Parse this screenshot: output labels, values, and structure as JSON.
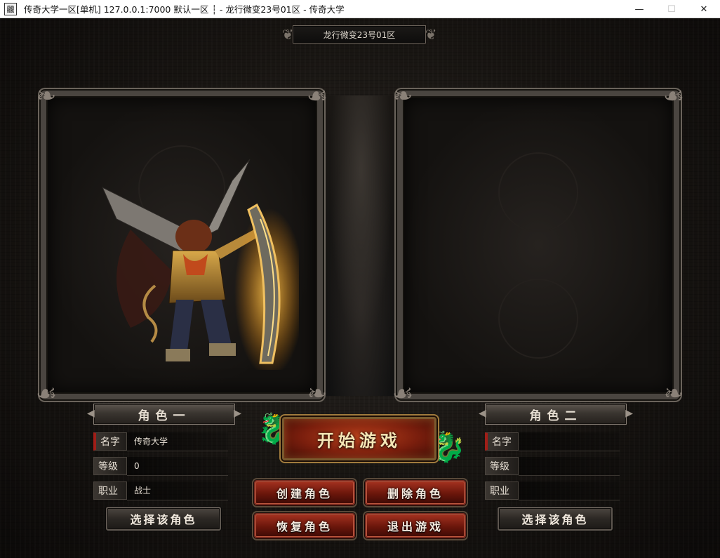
{
  "window": {
    "title": "传奇大学一区[单机] 127.0.0.1:7000   默认一区 ┆ - 龙行微变23号01区 - 传奇大学",
    "app_icon_glyph": "龖",
    "minimize": "—",
    "maximize": "☐",
    "close": "✕"
  },
  "server_name": "龙行微变23号01区",
  "roles": [
    {
      "header": "角色一",
      "name_label": "名字",
      "name_value": "传奇大学",
      "level_label": "等级",
      "level_value": "0",
      "job_label": "职业",
      "job_value": "战士",
      "select_button": "选择该角色"
    },
    {
      "header": "角色二",
      "name_label": "名字",
      "name_value": "",
      "level_label": "等级",
      "level_value": "",
      "job_label": "职业",
      "job_value": "",
      "select_button": "选择该角色"
    }
  ],
  "actions": {
    "start_game": "开始游戏",
    "create_role": "创建角色",
    "delete_role": "删除角色",
    "restore_role": "恢复角色",
    "exit_game": "退出游戏"
  },
  "colors": {
    "accent_red": "#a3311f",
    "gold": "#b58b45",
    "frame_gray": "#4a4540"
  }
}
